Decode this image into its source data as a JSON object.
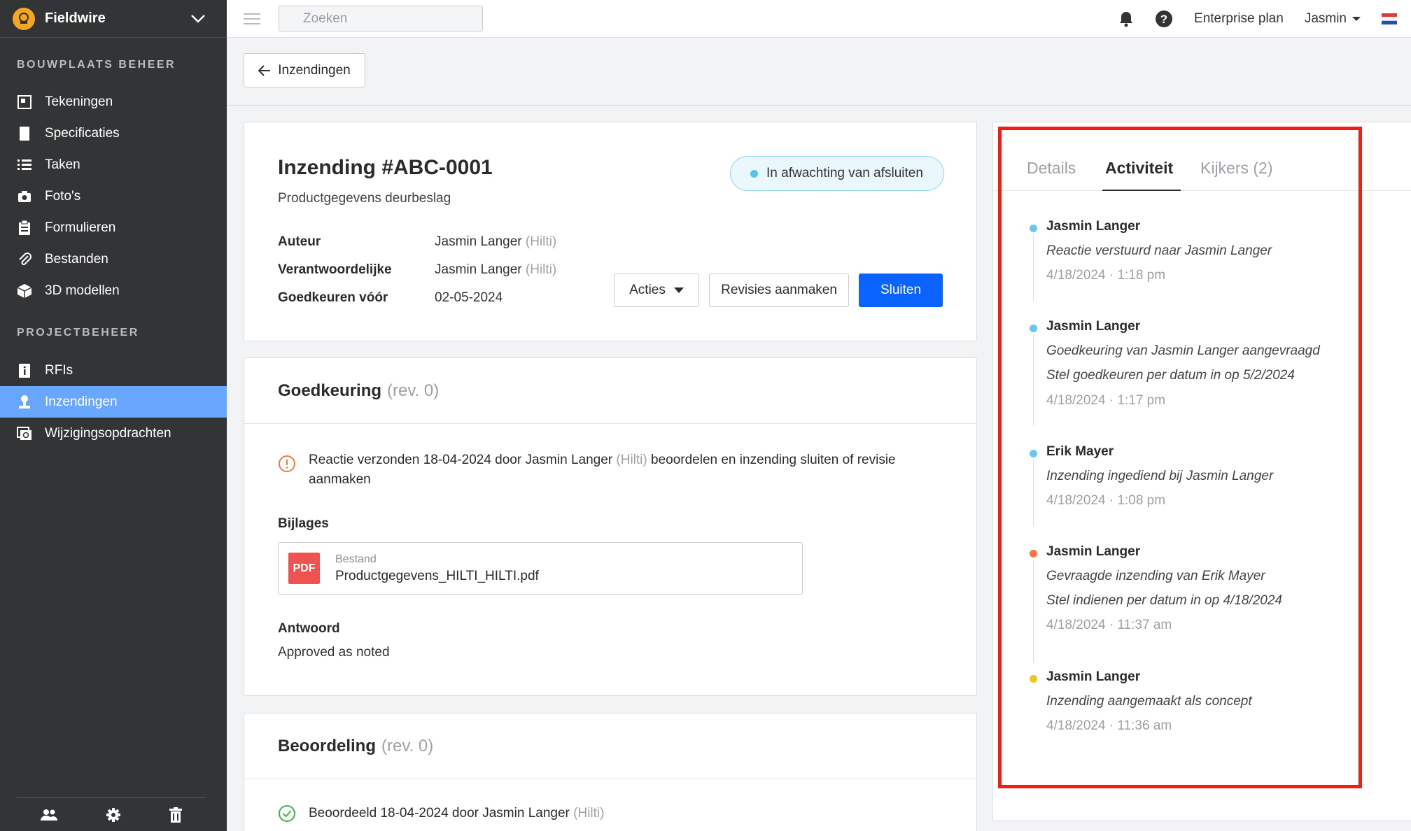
{
  "app": {
    "name": "Fieldwire"
  },
  "sidebar": {
    "sections": [
      {
        "title": "BOUWPLAATS BEHEER",
        "items": [
          {
            "label": "Tekeningen",
            "icon": "drawings-icon"
          },
          {
            "label": "Specificaties",
            "icon": "specs-icon"
          },
          {
            "label": "Taken",
            "icon": "tasks-icon"
          },
          {
            "label": "Foto's",
            "icon": "camera-icon"
          },
          {
            "label": "Formulieren",
            "icon": "forms-icon"
          },
          {
            "label": "Bestanden",
            "icon": "paperclip-icon"
          },
          {
            "label": "3D modellen",
            "icon": "cube-icon"
          }
        ]
      },
      {
        "title": "PROJECTBEHEER",
        "items": [
          {
            "label": "RFIs",
            "icon": "rfi-icon"
          },
          {
            "label": "Inzendingen",
            "icon": "submittal-icon",
            "active": true
          },
          {
            "label": "Wijzigingsopdrachten",
            "icon": "change-order-icon"
          }
        ]
      }
    ],
    "footer_icons": [
      "people-icon",
      "gear-icon",
      "trash-icon"
    ]
  },
  "topbar": {
    "search_placeholder": "Zoeken",
    "plan": "Enterprise plan",
    "user": "Jasmin"
  },
  "back_button": {
    "label": "Inzendingen"
  },
  "submittal": {
    "title": "Inzending #ABC-0001",
    "subtitle": "Productgegevens deurbeslag",
    "status": "In afwachting van afsluiten",
    "meta": [
      {
        "key": "Auteur",
        "value": "Jasmin Langer",
        "company": "(Hilti)"
      },
      {
        "key": "Verantwoordelijke",
        "value": "Jasmin Langer",
        "company": "(Hilti)"
      },
      {
        "key": "Goedkeuren vóór",
        "value": "02-05-2024",
        "company": ""
      }
    ],
    "actions": {
      "acties": "Acties",
      "revisies": "Revisies aanmaken",
      "sluiten": "Sluiten"
    }
  },
  "approval": {
    "title": "Goedkeuring",
    "rev": "(rev. 0)",
    "notice_pre": "Reactie verzonden 18-04-2024 door Jasmin Langer",
    "notice_company": "(Hilti)",
    "notice_post": "beoordelen en inzending sluiten of revisie aanmaken",
    "attachments_label": "Bijlages",
    "file": {
      "type_label": "Bestand",
      "name": "Productgegevens_HILTI_HILTI.pdf",
      "badge": "PDF"
    },
    "answer_label": "Antwoord",
    "answer_value": "Approved as noted"
  },
  "review": {
    "title": "Beoordeling",
    "rev": "(rev. 0)",
    "line_pre": "Beoordeeld 18-04-2024 door Jasmin Langer",
    "line_company": "(Hilti)"
  },
  "panel": {
    "tabs": [
      {
        "label": "Details",
        "active": false
      },
      {
        "label": "Activiteit",
        "active": true
      },
      {
        "label": "Kijkers (2)",
        "active": false
      }
    ],
    "activity": [
      {
        "name": "Jasmin Langer",
        "lines": [
          "Reactie verstuurd naar Jasmin Langer"
        ],
        "time": "4/18/2024 · 1:18 pm",
        "color": "#66c8f3"
      },
      {
        "name": "Jasmin Langer",
        "lines": [
          "Goedkeuring van Jasmin Langer aangevraagd",
          "Stel goedkeuren per datum in op 5/2/2024"
        ],
        "time": "4/18/2024 · 1:17 pm",
        "color": "#66c8f3"
      },
      {
        "name": "Erik Mayer",
        "lines": [
          "Inzending ingediend bij Jasmin Langer"
        ],
        "time": "4/18/2024 · 1:08 pm",
        "color": "#66c8f3"
      },
      {
        "name": "Jasmin Langer",
        "lines": [
          "Gevraagde inzending van Erik Mayer",
          "Stel indienen per datum in op 4/18/2024"
        ],
        "time": "4/18/2024 · 11:37 am",
        "color": "#f07a3c"
      },
      {
        "name": "Jasmin Langer",
        "lines": [
          "Inzending aangemaakt als concept"
        ],
        "time": "4/18/2024 · 11:36 am",
        "color": "#f5c518"
      }
    ]
  },
  "colors": {
    "accent": "#0b63ff",
    "sidebar_active": "#69a7ff",
    "highlight": "#f41d11"
  }
}
